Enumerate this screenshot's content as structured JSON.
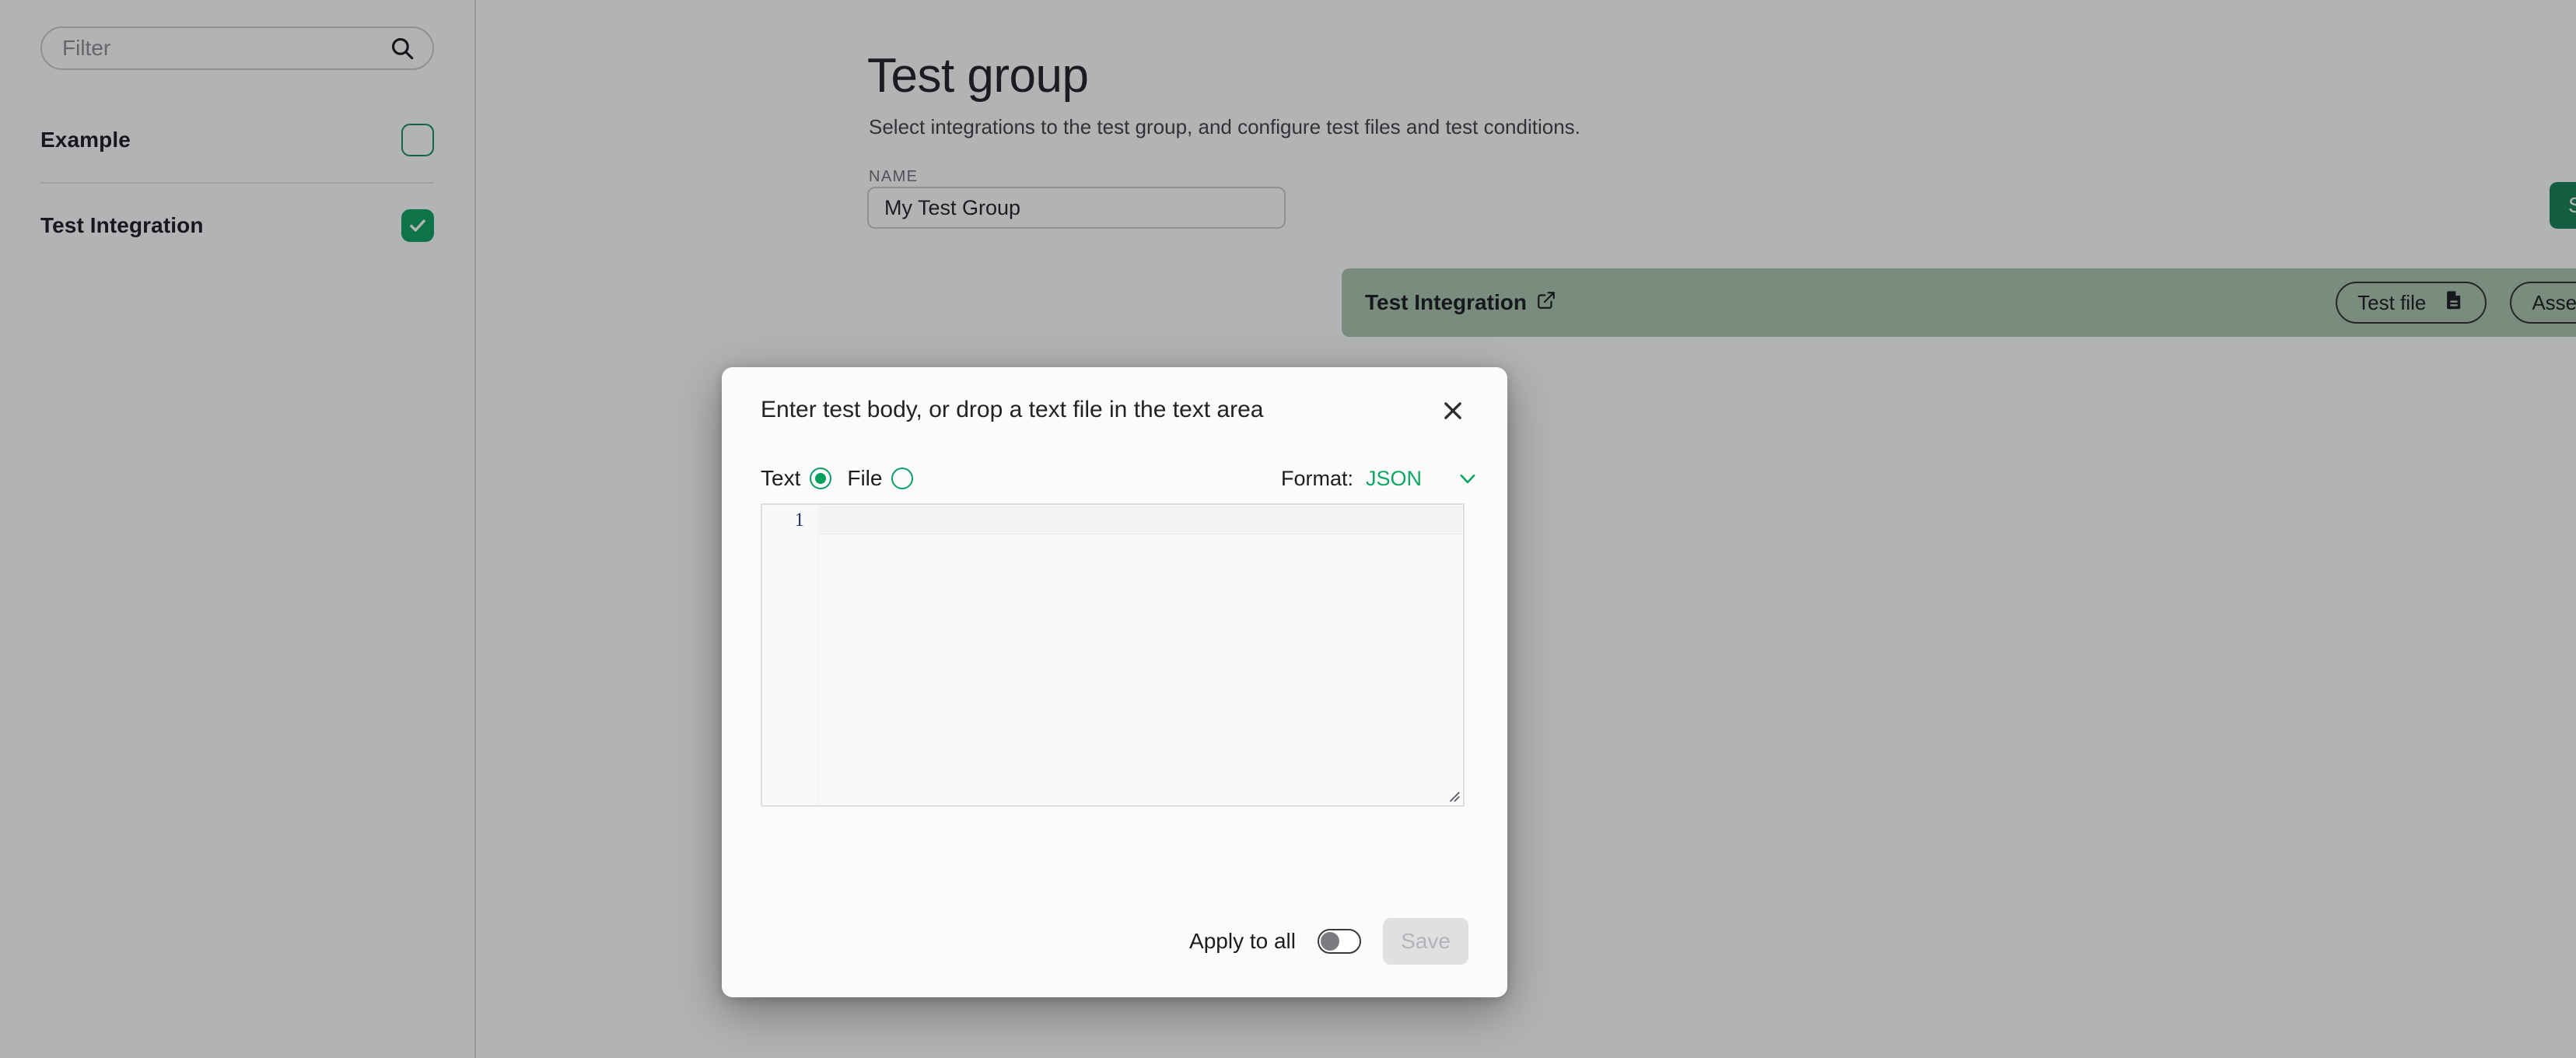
{
  "sidebar": {
    "filter": {
      "placeholder": "Filter",
      "value": "",
      "icon": "search-icon"
    },
    "items": [
      {
        "label": "Example",
        "checked": false
      },
      {
        "label": "Test Integration",
        "checked": true
      }
    ]
  },
  "main": {
    "title": "Test group",
    "subtitle": "Select integrations to the test group, and configure test files and test conditions.",
    "name_field": {
      "label": "NAME",
      "value": "My Test Group",
      "placeholder": ""
    },
    "save_button": {
      "label": "Save",
      "icon": "plus-icon"
    },
    "integration_card": {
      "name": "Test Integration",
      "link_icon": "external-link-icon",
      "actions": [
        {
          "label": "Test file",
          "icon": "document-icon"
        },
        {
          "label": "Assert",
          "icon": "flask-icon"
        }
      ]
    }
  },
  "modal": {
    "title": "Enter test body, or drop a text file in the text area",
    "close_icon": "close-icon",
    "source_options": [
      {
        "label": "Text",
        "selected": true
      },
      {
        "label": "File",
        "selected": false
      }
    ],
    "format": {
      "label": "Format:",
      "value": "JSON",
      "chevron_icon": "chevron-down-icon"
    },
    "editor": {
      "line_number": "1",
      "content": "",
      "placeholder": ""
    },
    "footer": {
      "apply_to_all_label": "Apply to all",
      "apply_to_all_on": false,
      "save_label": "Save",
      "save_disabled": true
    }
  },
  "colors": {
    "accent_green": "#06A05E",
    "save_green": "#0E7D4F",
    "card_green": "#A9C4AE",
    "format_green": "#0FA766",
    "disabled_gray": "#DFE0E2"
  }
}
